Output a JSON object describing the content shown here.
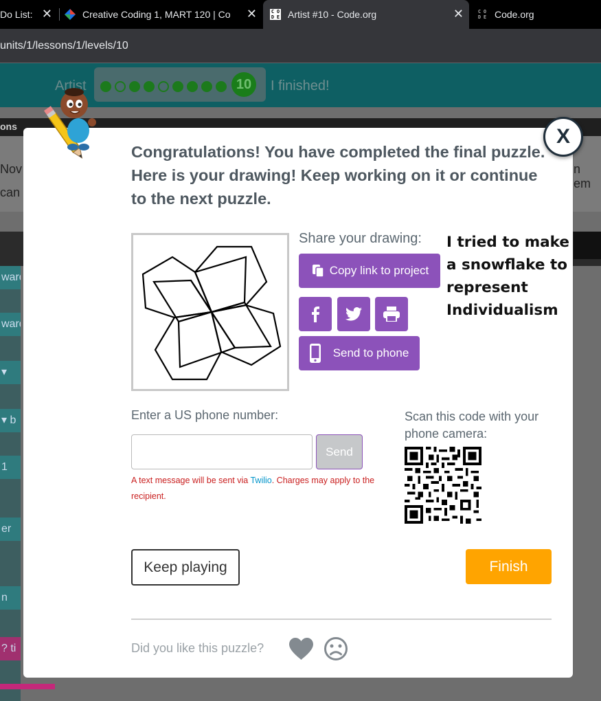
{
  "browser": {
    "tabs": [
      {
        "label": "Do List:",
        "close": "✕"
      },
      {
        "label": "Creative Coding 1, MART 120 | Co",
        "close": "✕"
      },
      {
        "label": "Artist #10 - Code.org",
        "close": "✕"
      },
      {
        "label": "Code.org",
        "close": ""
      }
    ],
    "url": "units/1/lessons/1/levels/10"
  },
  "background_page": {
    "app_label": "Artist",
    "level_number": "10",
    "finished_text": "I finished!",
    "tab_label": "ons",
    "panel_line1": "Nov",
    "panel_line2": "can",
    "panel_right": "n em",
    "side_cells": [
      "ward",
      "ward",
      "▾",
      "▾ b",
      "1",
      "er",
      "n",
      "? ti"
    ]
  },
  "modal": {
    "close_label": "X",
    "title": "Congratulations! You have completed the final puzzle. Here is your drawing! Keep working on it or continue to the next puzzle.",
    "share": {
      "label": "Share your drawing:",
      "copy_link": "Copy link to project",
      "send_to_phone": "Send to phone",
      "icons": [
        "facebook-icon",
        "twitter-icon",
        "print-icon",
        "clipboard-icon",
        "phone-icon"
      ]
    },
    "drawing_note": "I tried to make a snowflake to represent Individualism",
    "phone": {
      "label": "Enter a US phone number:",
      "value": "",
      "placeholder": "",
      "send_label": "Send",
      "note_prefix": "A text message will be sent via ",
      "note_link": "Twilio",
      "note_suffix": ". Charges may apply to the recipient."
    },
    "qr": {
      "label": "Scan this code with your phone camera:"
    },
    "keep_playing": "Keep playing",
    "finish": "Finish",
    "feedback": {
      "label": "Did you like this puzzle?"
    }
  },
  "colors": {
    "purple": "#8c52ba",
    "orange": "#ffa400",
    "title_text": "#4d575f",
    "error_text": "#c91e1e",
    "link": "#0094ca"
  }
}
